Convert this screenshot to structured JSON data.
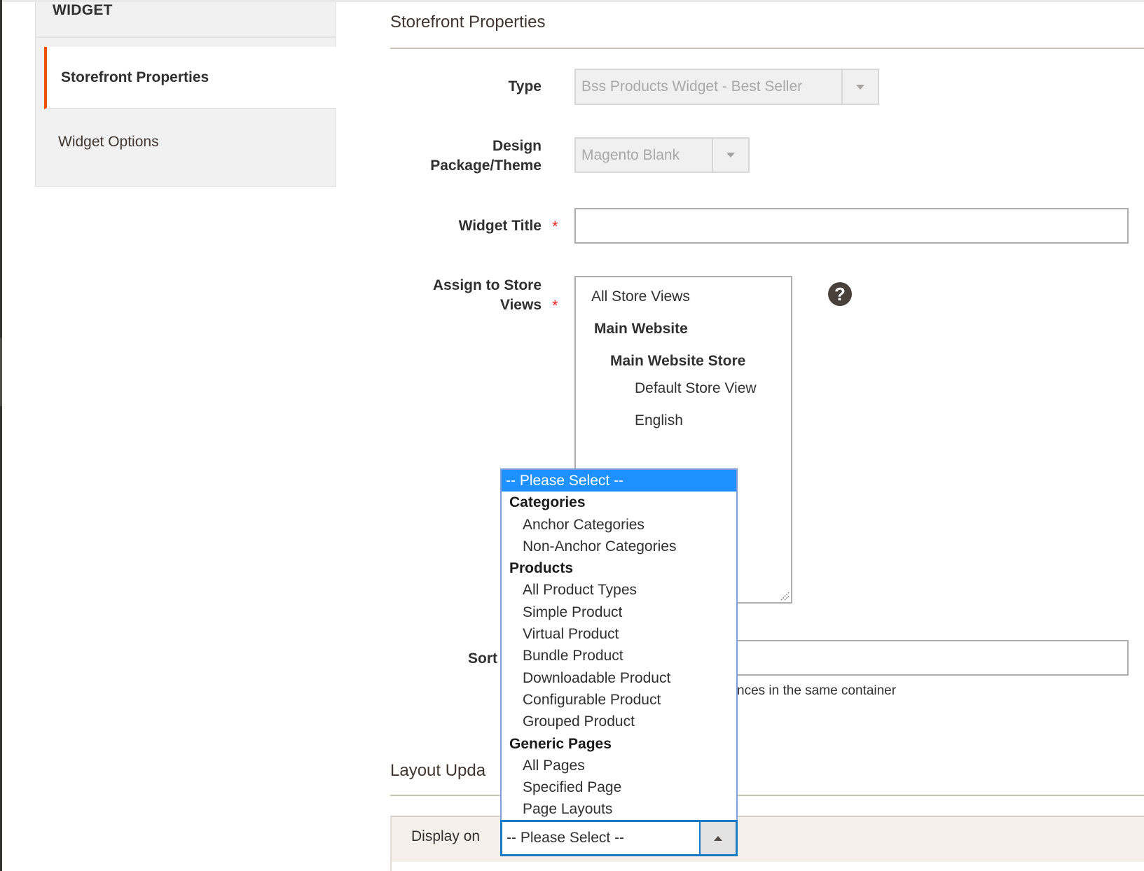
{
  "sidebar": {
    "title": "WIDGET",
    "items": [
      {
        "label": "Storefront Properties",
        "active": true
      },
      {
        "label": "Widget Options",
        "active": false
      }
    ]
  },
  "storefront": {
    "section_title": "Storefront Properties",
    "type": {
      "label": "Type",
      "value": "Bss Products Widget - Best Seller"
    },
    "design": {
      "label_line1": "Design",
      "label_line2": "Package/Theme",
      "value": "Magento Blank"
    },
    "widget_title": {
      "label": "Widget Title",
      "required_mark": "*",
      "value": ""
    },
    "store_views": {
      "label_line1": "Assign to Store",
      "label_line2": "Views",
      "required_mark": "*",
      "options": [
        {
          "label": "All Store Views",
          "level": 0,
          "bold": false
        },
        {
          "label": "Main Website",
          "level": 1,
          "bold": true
        },
        {
          "label": "Main Website Store",
          "level": 2,
          "bold": true
        },
        {
          "label": "Default Store View",
          "level": 3,
          "bold": false
        },
        {
          "label": "English",
          "level": 3,
          "bold": false
        }
      ],
      "help_icon": "?"
    },
    "sort_order": {
      "label": "Sort Order",
      "visible_label": "Sort",
      "value": "",
      "note_visible": "nces in the same container"
    }
  },
  "layout_updates": {
    "section_title": "Layout Updates",
    "visible_title": "Layout Upda",
    "display_on": {
      "label": "Display on",
      "value": "-- Please Select --",
      "open": true,
      "options": [
        {
          "label": "-- Please Select --",
          "kind": "option",
          "selected": true
        },
        {
          "label": "Categories",
          "kind": "group"
        },
        {
          "label": "Anchor Categories",
          "kind": "child"
        },
        {
          "label": "Non-Anchor Categories",
          "kind": "child"
        },
        {
          "label": "Products",
          "kind": "group"
        },
        {
          "label": "All Product Types",
          "kind": "child"
        },
        {
          "label": "Simple Product",
          "kind": "child"
        },
        {
          "label": "Virtual Product",
          "kind": "child"
        },
        {
          "label": "Bundle Product",
          "kind": "child"
        },
        {
          "label": "Downloadable Product",
          "kind": "child"
        },
        {
          "label": "Configurable Product",
          "kind": "child"
        },
        {
          "label": "Grouped Product",
          "kind": "child"
        },
        {
          "label": "Generic Pages",
          "kind": "group"
        },
        {
          "label": "All Pages",
          "kind": "child"
        },
        {
          "label": "Specified Page",
          "kind": "child"
        },
        {
          "label": "Page Layouts",
          "kind": "child"
        }
      ]
    }
  },
  "colors": {
    "accent_active_tab": "#eb5202",
    "dropdown_highlight": "#1e90ff",
    "focus_border": "#1979c3",
    "required": "#e22626"
  }
}
